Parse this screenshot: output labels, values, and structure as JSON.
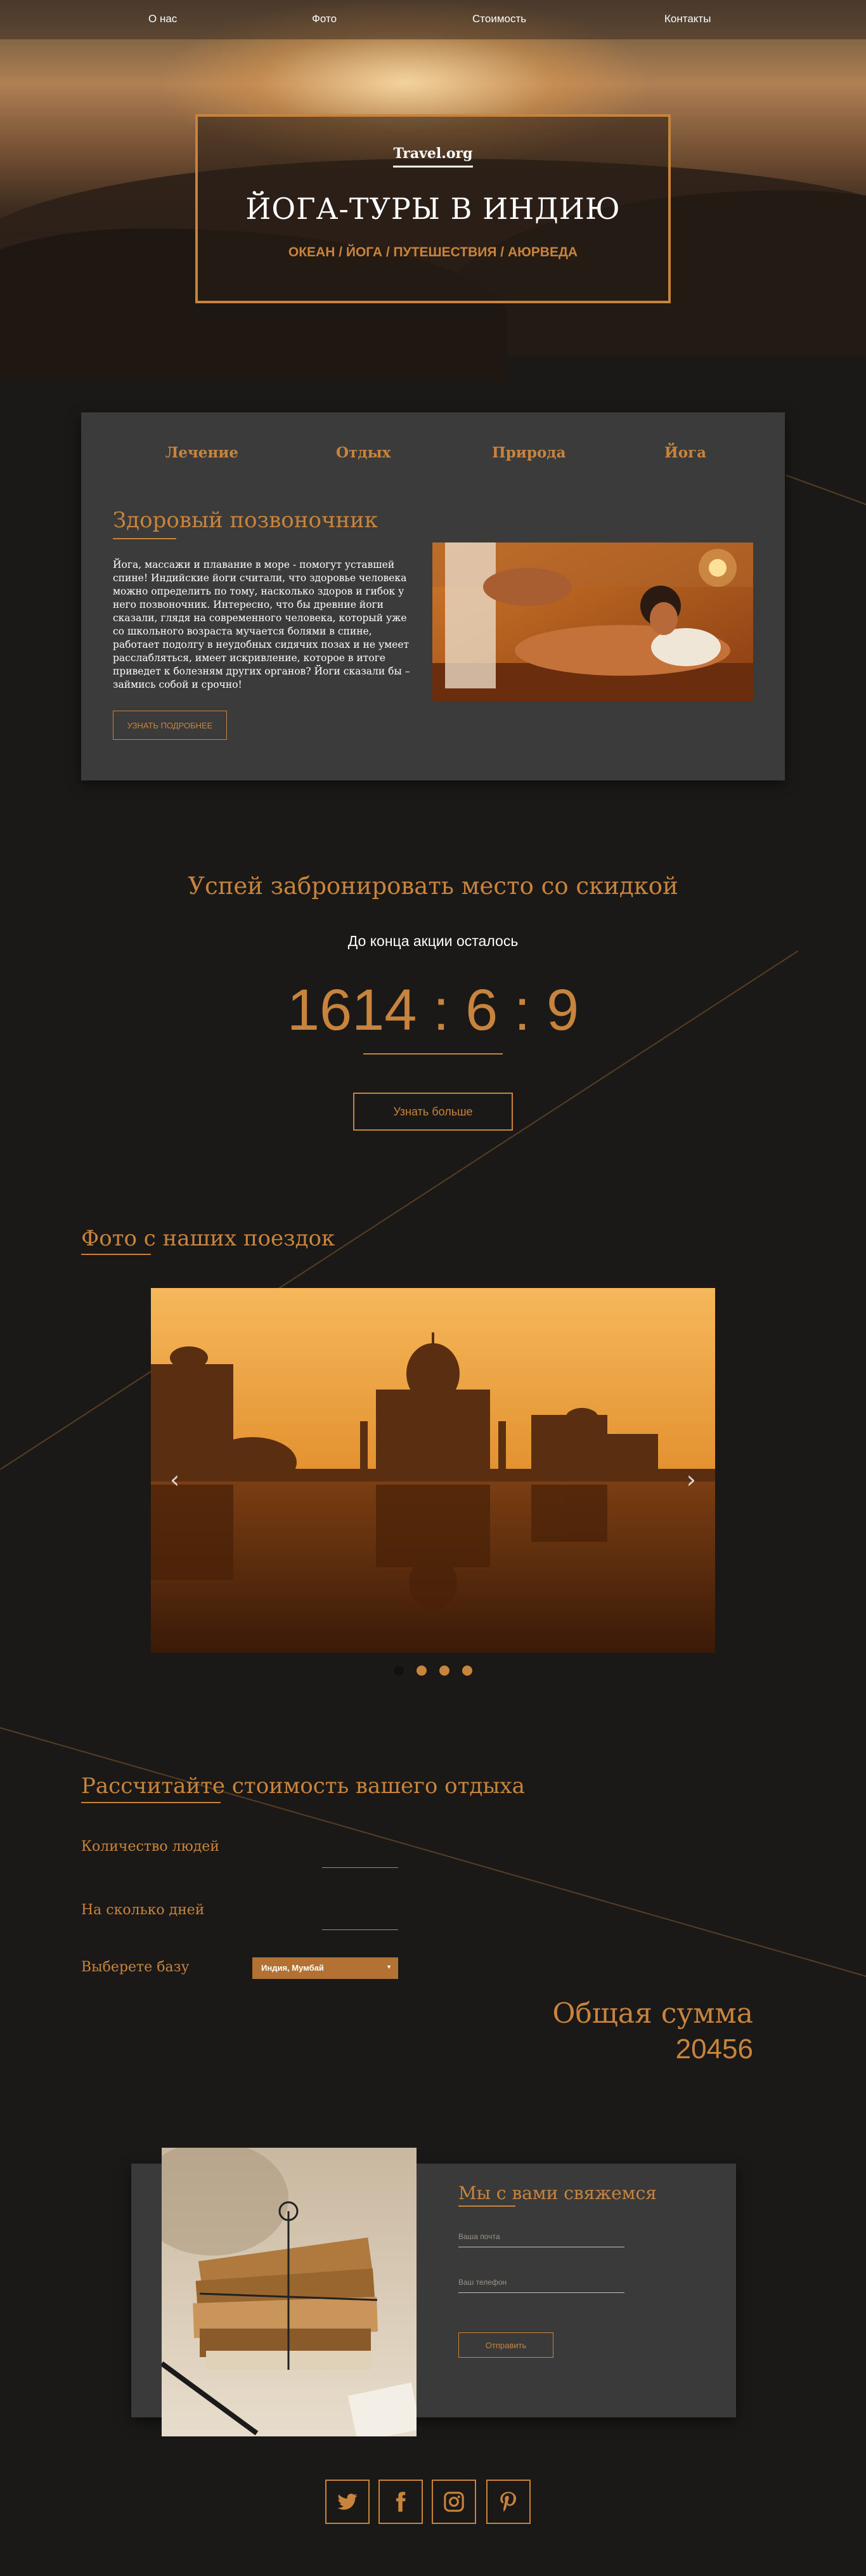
{
  "nav": {
    "items": [
      "О нас",
      "Фото",
      "Стоимость",
      "Контакты"
    ]
  },
  "hero": {
    "brand": "Travel.org",
    "title": "ЙОГА-ТУРЫ В ИНДИЮ",
    "subtitle": "ОКЕАН / ЙОГА / ПУТЕШЕСТВИЯ / АЮРВЕДА"
  },
  "services": {
    "tabs": [
      "Лечение",
      "Отдых",
      "Природа",
      "Йога"
    ],
    "heading": "Здоровый позвоночник",
    "text": "Йога, массажи и плавание в море - помогут уставшей спине! Индийские йоги считали, что здоровье человека можно определить по тому, насколько здоров и гибок у него позвоночник. Интересно, что бы древние йоги сказали, глядя на современного человека, который уже со школьного возраста мучается болями в спине, работает подолгу в неудобных сидячих позах и не умеет расслабляться, имеет искривление, которое в итоге приведет к болезням других органов? Йоги сказали бы – займись собой и срочно!",
    "button": "УЗНАТЬ ПОДРОБНЕЕ"
  },
  "countdown": {
    "heading": "Успей забронировать место со скидкой",
    "sub": "До конца акции осталось",
    "value": "1614 : 6 : 9",
    "button": "Узнать больше"
  },
  "gallery": {
    "heading": "Фото с наших поездок",
    "slide_count": 4,
    "active_slide": 1
  },
  "calc": {
    "heading": "Рассчитайте стоимость вашего отдыха",
    "people_label": "Количество людей",
    "days_label": "На сколько дней",
    "base_label": "Выберете базу",
    "base_value": "Индия, Мумбай",
    "total_label": "Общая сумма",
    "total_value": "20456"
  },
  "contact": {
    "heading": "Мы с вами свяжемся",
    "email_placeholder": "Ваша почта",
    "phone_placeholder": "Ваш телефон",
    "button": "Отправить"
  },
  "social": [
    "twitter-icon",
    "facebook-icon",
    "instagram-icon",
    "pinterest-icon"
  ],
  "colors": {
    "accent": "#c8843c",
    "background": "#1a1918",
    "card": "#3b3b3b"
  }
}
